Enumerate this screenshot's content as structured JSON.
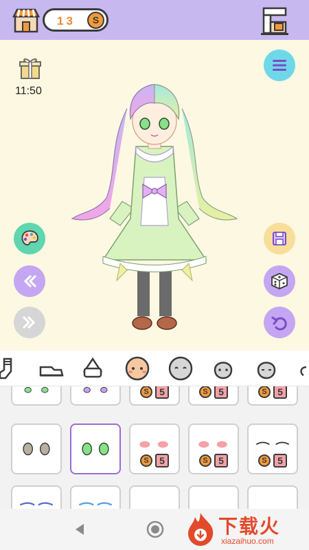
{
  "topbar": {
    "coins": "13",
    "coin_symbol": "S",
    "shop_icon": "shop-icon",
    "machine_icon": "coffee-machine-icon"
  },
  "stage": {
    "time": "11:50",
    "gift_icon": "gift-icon",
    "menu_icon": "menu-icon",
    "left_buttons": [
      "palette-icon",
      "rewind-icon",
      "fast-forward-icon"
    ],
    "right_buttons": [
      "save-icon",
      "dice-icon",
      "undo-icon"
    ]
  },
  "tabs": [
    "sock-icon",
    "shoe-icon",
    "bag-icon",
    "face-icon",
    "face-outline-icon",
    "head-icon",
    "head-outline-icon",
    "partial-icon"
  ],
  "grid": {
    "price_label": "5",
    "coin_label": "S"
  },
  "watermark": {
    "title": "下载火",
    "url": "xiazaihuo.com"
  },
  "colors": {
    "topbar": "#c7b8f0",
    "stage": "#fdf8e2",
    "accent_purple": "#9b6bd6",
    "coin_orange": "#f39a3a"
  }
}
